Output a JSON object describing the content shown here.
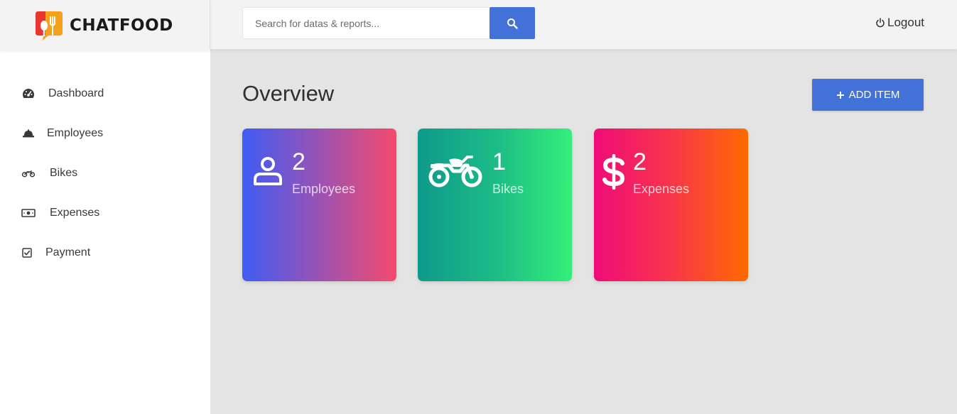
{
  "brand": {
    "name": "CHATFOOD",
    "logo_icon": "chatfood-logo-icon"
  },
  "search": {
    "placeholder": "Search for datas & reports...",
    "icon": "search-icon"
  },
  "header": {
    "logout_label": "Logout",
    "logout_icon": "power-icon"
  },
  "sidebar": {
    "items": [
      {
        "label": "Dashboard",
        "icon": "gauge-icon"
      },
      {
        "label": "Employees",
        "icon": "hard-hat-icon"
      },
      {
        "label": "Bikes",
        "icon": "motorcycle-icon"
      },
      {
        "label": "Expenses",
        "icon": "banknote-icon"
      },
      {
        "label": "Payment",
        "icon": "checkbox-icon"
      }
    ]
  },
  "main": {
    "title": "Overview",
    "add_button_label": "ADD ITEM",
    "add_button_icon": "plus-icon",
    "cards": [
      {
        "count": "2",
        "label": "Employees",
        "icon": "user-icon"
      },
      {
        "count": "1",
        "label": "Bikes",
        "icon": "motorcycle-icon"
      },
      {
        "count": "2",
        "label": "Expenses",
        "icon": "dollar-icon"
      }
    ]
  },
  "colors": {
    "accent": "#4272d7",
    "page_background": "#e4e4e4",
    "header_background": "#f3f3f3",
    "sidebar_background": "#ffffff"
  }
}
